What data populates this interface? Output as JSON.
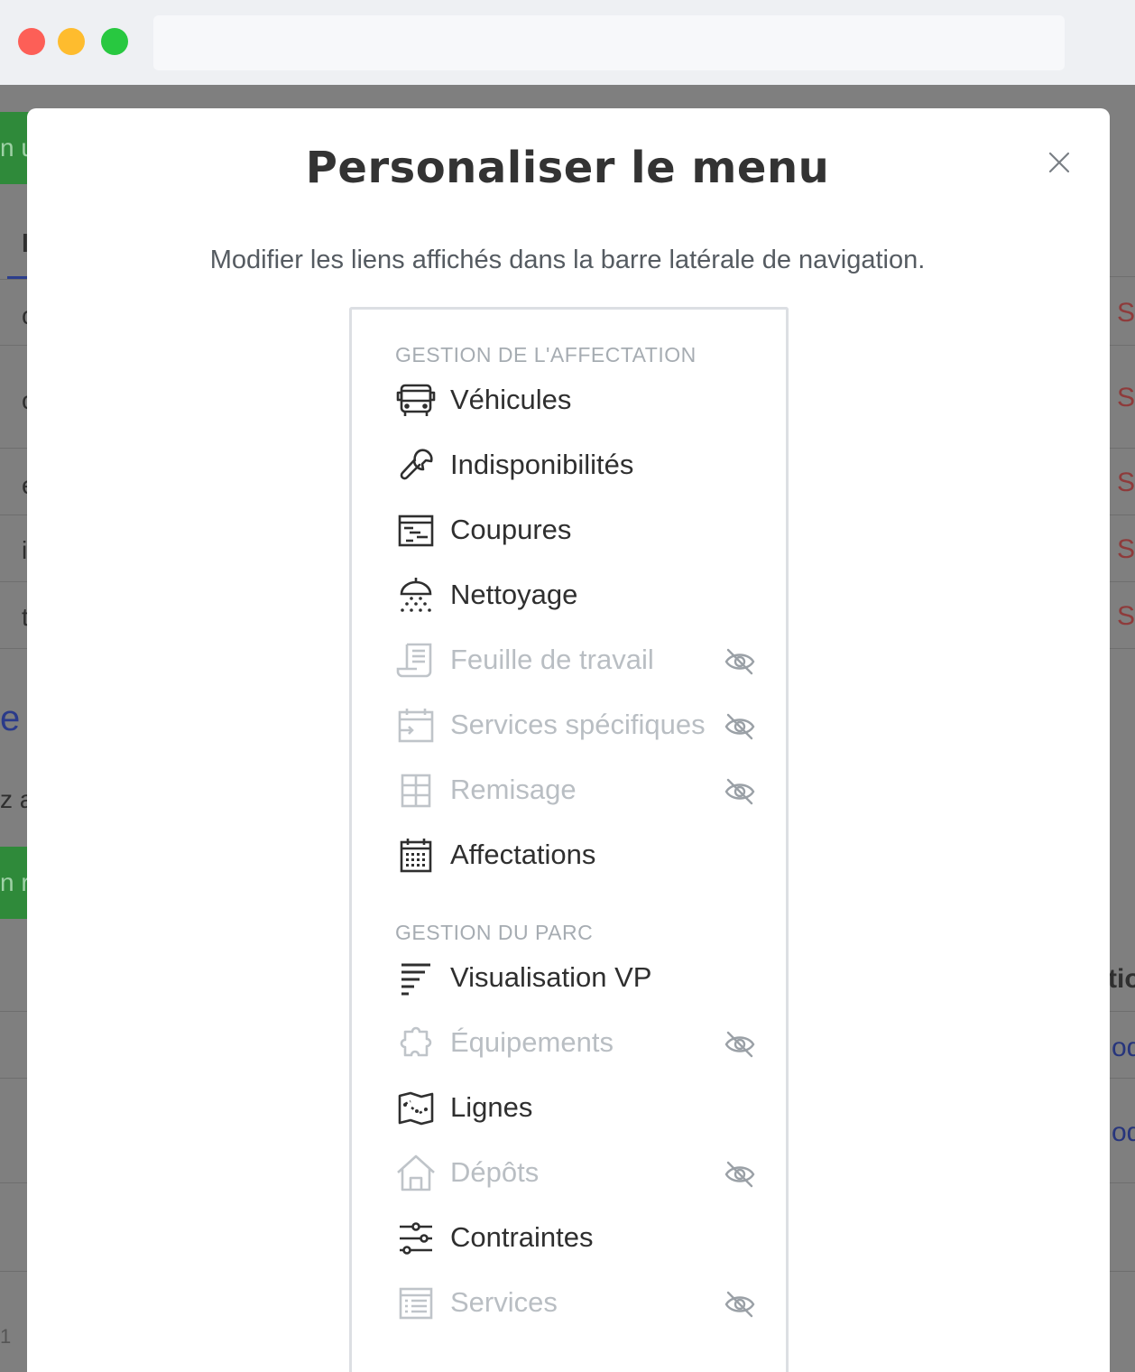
{
  "modal": {
    "title": "Personaliser le menu",
    "description": "Modifier les liens affichés dans la barre latérale de navigation."
  },
  "sections": [
    {
      "title": "GESTION DE L'AFFECTATION",
      "items": [
        {
          "label": "Véhicules",
          "icon": "bus-icon",
          "hidden": false
        },
        {
          "label": "Indisponibilités",
          "icon": "wrench-icon",
          "hidden": false
        },
        {
          "label": "Coupures",
          "icon": "gantt-icon",
          "hidden": false
        },
        {
          "label": "Nettoyage",
          "icon": "shower-icon",
          "hidden": false
        },
        {
          "label": "Feuille de travail",
          "icon": "worksheet-icon",
          "hidden": true
        },
        {
          "label": "Services spécifiques",
          "icon": "calendar-arrow-icon",
          "hidden": true
        },
        {
          "label": "Remisage",
          "icon": "grid-icon",
          "hidden": true
        },
        {
          "label": "Affectations",
          "icon": "calendar-icon",
          "hidden": false
        }
      ]
    },
    {
      "title": "GESTION DU PARC",
      "items": [
        {
          "label": "Visualisation VP",
          "icon": "lines-icon",
          "hidden": false
        },
        {
          "label": "Équipements",
          "icon": "puzzle-icon",
          "hidden": true
        },
        {
          "label": "Lignes",
          "icon": "map-icon",
          "hidden": false
        },
        {
          "label": "Dépôts",
          "icon": "house-icon",
          "hidden": true
        },
        {
          "label": "Contraintes",
          "icon": "sliders-icon",
          "hidden": false
        },
        {
          "label": "Services",
          "icon": "list-icon",
          "hidden": true
        }
      ]
    }
  ],
  "background": {
    "left_fragments": [
      "n u",
      "l",
      "c",
      "c",
      "e",
      "i",
      "t",
      "e",
      "z a",
      "n r",
      "1"
    ],
    "right_fragments": [
      "S",
      "S",
      "S",
      "S",
      "S",
      "tio",
      "odi",
      "odi"
    ]
  },
  "colors": {
    "overlay": "#7f7f7f",
    "title": "#333333",
    "section": "#a6acb2",
    "hidden_text": "#b9bec3",
    "green_button": "#2f8a3a"
  }
}
